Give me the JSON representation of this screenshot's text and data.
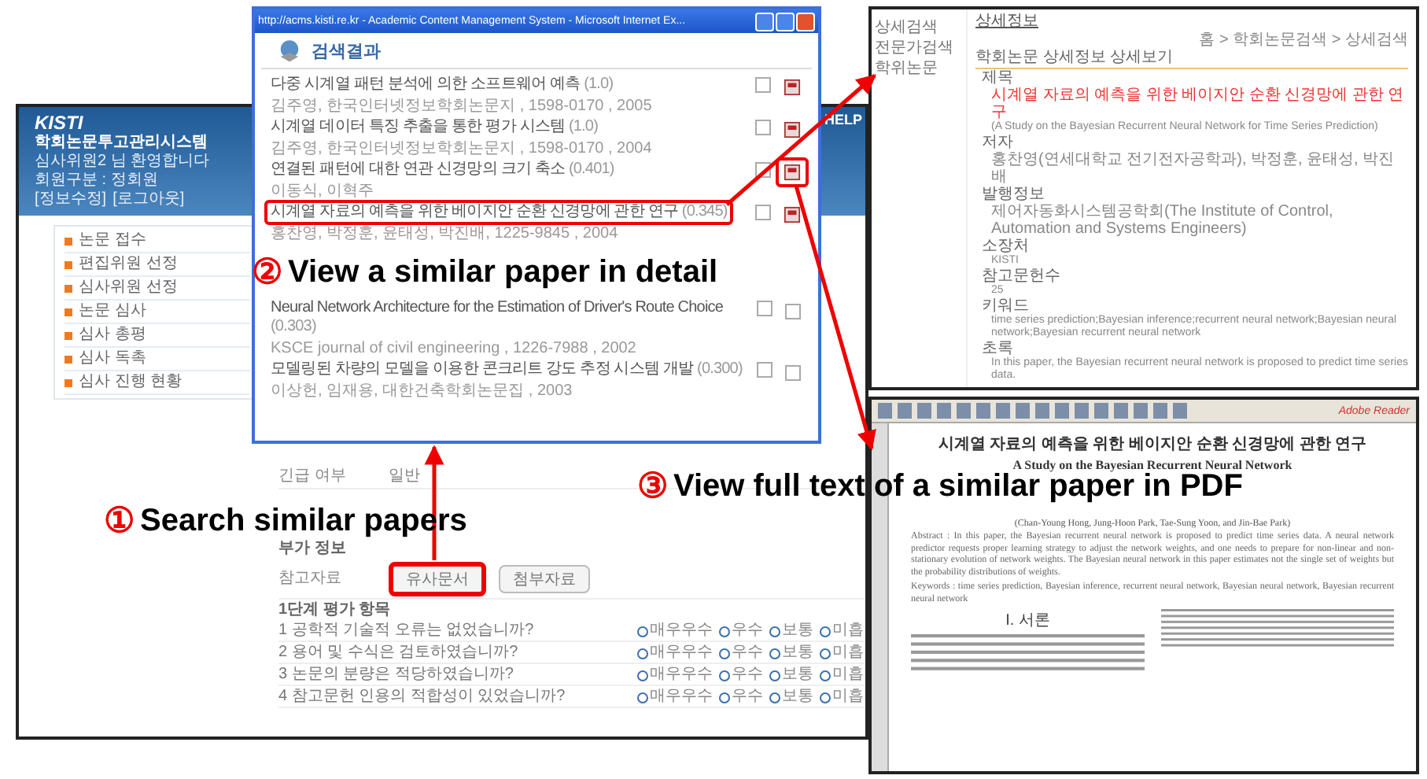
{
  "main_window": {
    "logo": "KISTI",
    "system_name": "학회논문투고관리시스템",
    "top_link": "HELP",
    "welcome": "심사위원2 님 환영합니다",
    "member_type": "회원구분 : 정회원",
    "account_links": [
      "[정보수정]",
      "[로그아웃]"
    ],
    "menu": [
      {
        "label": "논문 접수"
      },
      {
        "label": "편집위원 선정"
      },
      {
        "label": "심사위원 선정"
      },
      {
        "label": "논문 심사"
      },
      {
        "label": "심사 총평"
      },
      {
        "label": "심사 독촉"
      },
      {
        "label": "심사 진행 현황"
      }
    ],
    "urgent": {
      "label": "긴급 여부",
      "value": "일반"
    },
    "extra_info": {
      "heading": "부가 정보",
      "label": "참고자료",
      "buttons": [
        {
          "label": "유사문서",
          "highlighted": true
        },
        {
          "label": "첨부자료",
          "highlighted": false
        }
      ]
    },
    "evaluation": {
      "heading": "1단계 평가 항목",
      "questions": [
        {
          "number": "1",
          "text": "공학적 기술적 오류는 없었습니까?",
          "options": [
            {
              "label": "매우우수",
              "selected": false
            },
            {
              "label": "우수",
              "selected": false
            },
            {
              "label": "보통",
              "selected": false
            },
            {
              "label": "미흡",
              "selected": false
            }
          ]
        },
        {
          "number": "2",
          "text": "용어 및 수식은 검토하였습니까?",
          "options": [
            {
              "label": "매우우수",
              "selected": false
            },
            {
              "label": "우수",
              "selected": false
            },
            {
              "label": "보통",
              "selected": false
            },
            {
              "label": "미흡",
              "selected": false
            }
          ]
        },
        {
          "number": "3",
          "text": "논문의 분량은 적당하였습니까?",
          "options": [
            {
              "label": "매우우수",
              "selected": false
            },
            {
              "label": "우수",
              "selected": false
            },
            {
              "label": "보통",
              "selected": false
            },
            {
              "label": "미흡",
              "selected": false
            }
          ]
        },
        {
          "number": "4",
          "text": "참고문헌 인용의 적합성이 있었습니까?",
          "options": [
            {
              "label": "매우우수",
              "selected": false
            },
            {
              "label": "우수",
              "selected": false
            },
            {
              "label": "보통",
              "selected": false
            },
            {
              "label": "미흡",
              "selected": false
            }
          ]
        }
      ]
    }
  },
  "search_popup": {
    "title": "http://acms.kisti.re.kr - Academic Content Management System - Microsoft Internet Ex...",
    "heading": "검색결과",
    "results": [
      {
        "title": "다중 시계열 패턴 분석에 의한 소프트웨어 예측",
        "score": "(1.0)",
        "meta": "김주영, 한국인터넷정보학회논문지 , 1598-0170 , 2005",
        "full_text": true,
        "highlighted": false,
        "icon_highlighted": false
      },
      {
        "title": "시계열 데이터 특징 추출을 통한 평가 시스템",
        "score": "(1.0)",
        "meta": "김주영, 한국인터넷정보학회논문지 , 1598-0170 , 2004",
        "full_text": true,
        "highlighted": false,
        "icon_highlighted": false
      },
      {
        "title": "연결된 패턴에 대한 연관 신경망의 크기 축소",
        "score": "(0.401)",
        "meta": "이동식, 이혁주",
        "full_text": true,
        "highlighted": false,
        "icon_highlighted": true
      },
      {
        "title": "시계열 자료의 예측을 위한 베이지안 순환 신경망에 관한 연구",
        "score": "(0.345)",
        "meta": "홍찬영, 박정훈, 윤태성, 박진배, 1225-9845 , 2004",
        "full_text": true,
        "highlighted": true,
        "icon_highlighted": false
      },
      {
        "title": "Neural Network Architecture for the Estimation of Driver's Route Choice",
        "score": "(0.303)",
        "meta": "KSCE journal of civil engineering , 1226-7988 , 2002",
        "full_text": false,
        "highlighted": false,
        "icon_highlighted": false
      },
      {
        "title": "모델링된 차량의 모델을 이용한 콘크리트 강도 추정 시스템 개발",
        "score": "(0.300)",
        "meta": "이상헌, 임재용, 대한건축학회논문집 , 2003",
        "full_text": false,
        "highlighted": false,
        "icon_highlighted": false
      }
    ]
  },
  "detail_window": {
    "nav": [
      "상세검색",
      "전문가검색",
      "학위논문"
    ],
    "heading": "상세정보",
    "breadcrumb": "홈 > 학회논문검색 > 상세검색",
    "subheading": "학회논문 상세정보 상세보기",
    "fields": [
      {
        "label": "제목",
        "values": [
          {
            "text": "시계열 자료의 예측을 위한 베이지안 순환 신경망에 관한 연구",
            "kind": "title"
          },
          {
            "text": "(A Study on the Bayesian Recurrent Neural Network for Time Series Prediction)",
            "kind": "latin"
          }
        ]
      },
      {
        "label": "저자",
        "values": [
          {
            "text": "홍찬영(연세대학교 전기전자공학과), 박정훈, 윤태성, 박진배",
            "kind": "korean"
          }
        ]
      },
      {
        "label": "발행정보",
        "values": [
          {
            "text": "제어자동화시스템공학회(The Institute of Control, Automation and Systems Engineers)",
            "kind": "korean"
          }
        ]
      },
      {
        "label": "소장처",
        "values": [
          {
            "text": "KISTI",
            "kind": "latin"
          }
        ]
      },
      {
        "label": "참고문헌수",
        "values": [
          {
            "text": "25",
            "kind": "latin"
          }
        ]
      },
      {
        "label": "키워드",
        "values": [
          {
            "text": "time series prediction;Bayesian inference;recurrent neural network;Bayesian neural network;Bayesian recurrent neural network",
            "kind": "latin"
          }
        ]
      },
      {
        "label": "초록",
        "values": [
          {
            "text": "In this paper, the Bayesian recurrent neural network is proposed to predict time series data.",
            "kind": "latin"
          }
        ]
      }
    ]
  },
  "pdf_window": {
    "brand": "Adobe Reader",
    "title_ko": "시계열 자료의 예측을 위한 베이지안 순환 신경망에 관한 연구",
    "title_en": "A Study on the Bayesian Recurrent Neural Network",
    "authors": "(Chan-Young Hong, Jung-Hoon Park, Tae-Sung Yoon, and Jin-Bae Park)",
    "abstract": "Abstract : In this paper, the Bayesian recurrent neural network is proposed to predict time series data. A neural network predictor requests proper learning strategy to adjust the network weights, and one needs to prepare for non-linear and non-stationary evolution of network weights. The Bayesian neural network in this paper estimates not the single set of weights but the probability distributions of weights.",
    "keywords": "Keywords : time series prediction, Bayesian inference, recurrent neural network, Bayesian neural network, Bayesian recurrent neural network",
    "section": "I. 서론"
  },
  "annotations": [
    {
      "number": "①",
      "text": "Search similar papers"
    },
    {
      "number": "②",
      "text": "View a similar paper in detail"
    },
    {
      "number": "③",
      "text": "View full text of a similar paper in PDF"
    }
  ]
}
